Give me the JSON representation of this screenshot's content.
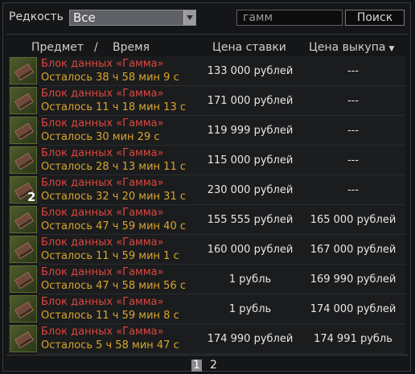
{
  "filter": {
    "rarity_label": "Редкость",
    "rarity_value": "Все",
    "search_value": "гамм",
    "search_button": "Поиск"
  },
  "columns": {
    "item": "Предмет",
    "slash": "/",
    "time": "Время",
    "bid": "Цена ставки",
    "buyout": "Цена выкупа"
  },
  "rows": [
    {
      "name": "Блок данных «Гамма»",
      "time": "Осталось 38 ч 58 мин 9 с",
      "bid": "133 000 рублей",
      "buyout": "---",
      "qty": ""
    },
    {
      "name": "Блок данных «Гамма»",
      "time": "Осталось 11 ч 18 мин 13 с",
      "bid": "171 000 рублей",
      "buyout": "---",
      "qty": ""
    },
    {
      "name": "Блок данных «Гамма»",
      "time": "Осталось 30 мин 29 с",
      "bid": "119 999 рублей",
      "buyout": "---",
      "qty": ""
    },
    {
      "name": "Блок данных «Гамма»",
      "time": "Осталось 28 ч 13 мин 11 с",
      "bid": "115 000 рублей",
      "buyout": "---",
      "qty": ""
    },
    {
      "name": "Блок данных «Гамма»",
      "time": "Осталось 32 ч 20 мин 31 с",
      "bid": "230 000 рублей",
      "buyout": "---",
      "qty": "2"
    },
    {
      "name": "Блок данных «Гамма»",
      "time": "Осталось 47 ч 59 мин 40 с",
      "bid": "155 555 рублей",
      "buyout": "165 000 рублей",
      "qty": ""
    },
    {
      "name": "Блок данных «Гамма»",
      "time": "Осталось 11 ч 59 мин 1 с",
      "bid": "160 000 рублей",
      "buyout": "167 000 рублей",
      "qty": ""
    },
    {
      "name": "Блок данных «Гамма»",
      "time": "Осталось 47 ч 58 мин 56 с",
      "bid": "1 рубль",
      "buyout": "169 990 рублей",
      "qty": ""
    },
    {
      "name": "Блок данных «Гамма»",
      "time": "Осталось 11 ч 59 мин 8 с",
      "bid": "1 рубль",
      "buyout": "174 000 рублей",
      "qty": ""
    },
    {
      "name": "Блок данных «Гамма»",
      "time": "Осталось 5 ч 58 мин 47 с",
      "bid": "174 990 рублей",
      "buyout": "174 991 рубль",
      "qty": ""
    }
  ],
  "pagination": {
    "pages": [
      "1",
      "2"
    ],
    "current": "1"
  },
  "icons": {
    "item": "data-block-icon",
    "sort": "sort-down-icon",
    "dropdown": "chevron-down-icon"
  },
  "colors": {
    "item_name": "#e0453c",
    "time_left": "#d9a62a"
  }
}
